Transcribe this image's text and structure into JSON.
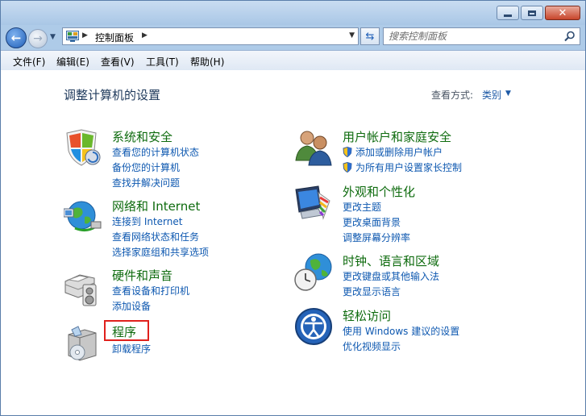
{
  "window": {
    "title": "控制面板"
  },
  "nav": {
    "address_path": "控制面板",
    "search_placeholder": "搜索控制面板"
  },
  "menu": {
    "items": [
      "文件(F)",
      "编辑(E)",
      "查看(V)",
      "工具(T)",
      "帮助(H)"
    ]
  },
  "content": {
    "title": "调整计算机的设置",
    "view_label": "查看方式:",
    "view_value": "类别"
  },
  "categories_left": [
    {
      "title": "系统和安全",
      "links": [
        "查看您的计算机状态",
        "备份您的计算机",
        "查找并解决问题"
      ]
    },
    {
      "title": "网络和 Internet",
      "links": [
        "连接到 Internet",
        "查看网络状态和任务",
        "选择家庭组和共享选项"
      ]
    },
    {
      "title": "硬件和声音",
      "links": [
        "查看设备和打印机",
        "添加设备"
      ]
    },
    {
      "title": "程序",
      "links": [
        "卸载程序"
      ]
    }
  ],
  "categories_right": [
    {
      "title": "用户帐户和家庭安全",
      "links": [
        "添加或删除用户帐户",
        "为所有用户设置家长控制"
      ]
    },
    {
      "title": "外观和个性化",
      "links": [
        "更改主题",
        "更改桌面背景",
        "调整屏幕分辨率"
      ]
    },
    {
      "title": "时钟、语言和区域",
      "links": [
        "更改键盘或其他输入法",
        "更改显示语言"
      ]
    },
    {
      "title": "轻松访问",
      "links": [
        "使用 Windows 建议的设置",
        "优化视频显示"
      ]
    }
  ],
  "colors": {
    "category_title": "#0e6b0e",
    "link": "#0e58b0",
    "highlight": "#e0201c"
  }
}
